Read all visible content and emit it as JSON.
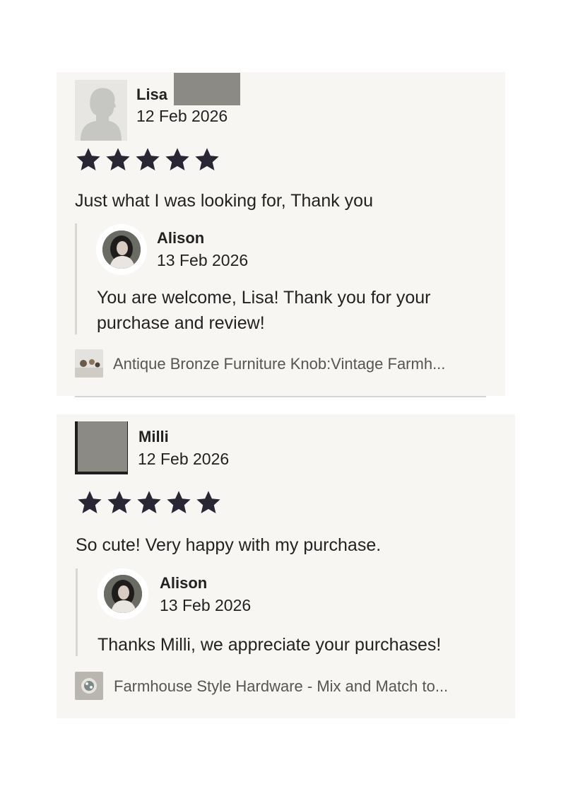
{
  "reviews": [
    {
      "reviewer_name": "Lisa",
      "date": "12 Feb 2026",
      "rating": 5,
      "text": "Just what I was looking for, Thank you",
      "reply": {
        "author": "Alison",
        "date": "13 Feb 2026",
        "text": "You are welcome, Lisa! Thank you for your purchase and review!"
      },
      "product": "Antique Bronze Furniture Knob:Vintage Farmh..."
    },
    {
      "reviewer_name": "Milli",
      "date": "12 Feb 2026",
      "rating": 5,
      "text": "So cute! Very happy with my purchase.",
      "reply": {
        "author": "Alison",
        "date": "13 Feb 2026",
        "text": "Thanks Milli, we appreciate your purchases!"
      },
      "product": "Farmhouse Style Hardware - Mix and Match to..."
    }
  ],
  "colors": {
    "card_background": "#f7f6f3",
    "star": "#2a2735",
    "redaction": "#8b8a85",
    "reply_bar": "#d9d7d2"
  }
}
